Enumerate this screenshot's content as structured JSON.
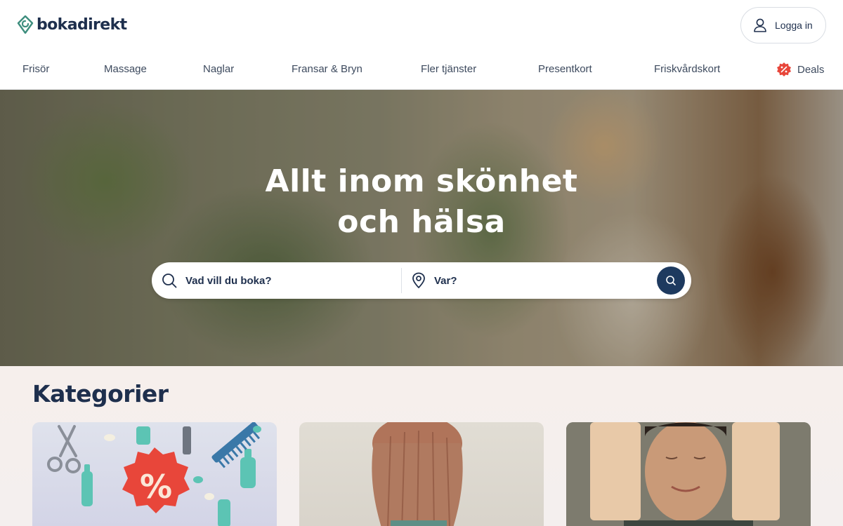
{
  "brand": {
    "name": "bokadirekt",
    "color": "#3e8e7e"
  },
  "header": {
    "login_label": "Logga in"
  },
  "nav": {
    "items": [
      "Frisör",
      "Massage",
      "Naglar",
      "Fransar & Bryn",
      "Fler tjänster",
      "Presentkort",
      "Friskvårdskort"
    ],
    "deals_label": "Deals",
    "deals_color": "#e8463a"
  },
  "hero": {
    "title_line1": "Allt inom skönhet",
    "title_line2": "och hälsa",
    "search_what_placeholder": "Vad vill du boka?",
    "search_where_placeholder": "Var?",
    "search_button_color": "#1e3a5f"
  },
  "categories": {
    "title": "Kategorier"
  }
}
